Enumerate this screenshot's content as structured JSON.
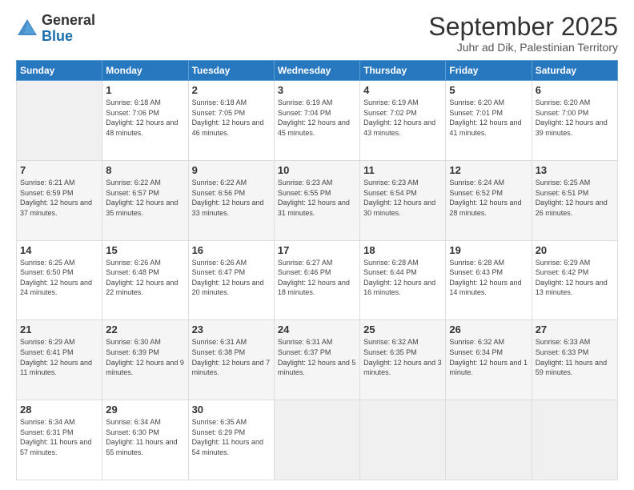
{
  "header": {
    "logo_general": "General",
    "logo_blue": "Blue",
    "month_title": "September 2025",
    "subtitle": "Juhr ad Dik, Palestinian Territory"
  },
  "days_of_week": [
    "Sunday",
    "Monday",
    "Tuesday",
    "Wednesday",
    "Thursday",
    "Friday",
    "Saturday"
  ],
  "weeks": [
    [
      {
        "day": "",
        "sunrise": "",
        "sunset": "",
        "daylight": ""
      },
      {
        "day": "1",
        "sunrise": "Sunrise: 6:18 AM",
        "sunset": "Sunset: 7:06 PM",
        "daylight": "Daylight: 12 hours and 48 minutes."
      },
      {
        "day": "2",
        "sunrise": "Sunrise: 6:18 AM",
        "sunset": "Sunset: 7:05 PM",
        "daylight": "Daylight: 12 hours and 46 minutes."
      },
      {
        "day": "3",
        "sunrise": "Sunrise: 6:19 AM",
        "sunset": "Sunset: 7:04 PM",
        "daylight": "Daylight: 12 hours and 45 minutes."
      },
      {
        "day": "4",
        "sunrise": "Sunrise: 6:19 AM",
        "sunset": "Sunset: 7:02 PM",
        "daylight": "Daylight: 12 hours and 43 minutes."
      },
      {
        "day": "5",
        "sunrise": "Sunrise: 6:20 AM",
        "sunset": "Sunset: 7:01 PM",
        "daylight": "Daylight: 12 hours and 41 minutes."
      },
      {
        "day": "6",
        "sunrise": "Sunrise: 6:20 AM",
        "sunset": "Sunset: 7:00 PM",
        "daylight": "Daylight: 12 hours and 39 minutes."
      }
    ],
    [
      {
        "day": "7",
        "sunrise": "Sunrise: 6:21 AM",
        "sunset": "Sunset: 6:59 PM",
        "daylight": "Daylight: 12 hours and 37 minutes."
      },
      {
        "day": "8",
        "sunrise": "Sunrise: 6:22 AM",
        "sunset": "Sunset: 6:57 PM",
        "daylight": "Daylight: 12 hours and 35 minutes."
      },
      {
        "day": "9",
        "sunrise": "Sunrise: 6:22 AM",
        "sunset": "Sunset: 6:56 PM",
        "daylight": "Daylight: 12 hours and 33 minutes."
      },
      {
        "day": "10",
        "sunrise": "Sunrise: 6:23 AM",
        "sunset": "Sunset: 6:55 PM",
        "daylight": "Daylight: 12 hours and 31 minutes."
      },
      {
        "day": "11",
        "sunrise": "Sunrise: 6:23 AM",
        "sunset": "Sunset: 6:54 PM",
        "daylight": "Daylight: 12 hours and 30 minutes."
      },
      {
        "day": "12",
        "sunrise": "Sunrise: 6:24 AM",
        "sunset": "Sunset: 6:52 PM",
        "daylight": "Daylight: 12 hours and 28 minutes."
      },
      {
        "day": "13",
        "sunrise": "Sunrise: 6:25 AM",
        "sunset": "Sunset: 6:51 PM",
        "daylight": "Daylight: 12 hours and 26 minutes."
      }
    ],
    [
      {
        "day": "14",
        "sunrise": "Sunrise: 6:25 AM",
        "sunset": "Sunset: 6:50 PM",
        "daylight": "Daylight: 12 hours and 24 minutes."
      },
      {
        "day": "15",
        "sunrise": "Sunrise: 6:26 AM",
        "sunset": "Sunset: 6:48 PM",
        "daylight": "Daylight: 12 hours and 22 minutes."
      },
      {
        "day": "16",
        "sunrise": "Sunrise: 6:26 AM",
        "sunset": "Sunset: 6:47 PM",
        "daylight": "Daylight: 12 hours and 20 minutes."
      },
      {
        "day": "17",
        "sunrise": "Sunrise: 6:27 AM",
        "sunset": "Sunset: 6:46 PM",
        "daylight": "Daylight: 12 hours and 18 minutes."
      },
      {
        "day": "18",
        "sunrise": "Sunrise: 6:28 AM",
        "sunset": "Sunset: 6:44 PM",
        "daylight": "Daylight: 12 hours and 16 minutes."
      },
      {
        "day": "19",
        "sunrise": "Sunrise: 6:28 AM",
        "sunset": "Sunset: 6:43 PM",
        "daylight": "Daylight: 12 hours and 14 minutes."
      },
      {
        "day": "20",
        "sunrise": "Sunrise: 6:29 AM",
        "sunset": "Sunset: 6:42 PM",
        "daylight": "Daylight: 12 hours and 13 minutes."
      }
    ],
    [
      {
        "day": "21",
        "sunrise": "Sunrise: 6:29 AM",
        "sunset": "Sunset: 6:41 PM",
        "daylight": "Daylight: 12 hours and 11 minutes."
      },
      {
        "day": "22",
        "sunrise": "Sunrise: 6:30 AM",
        "sunset": "Sunset: 6:39 PM",
        "daylight": "Daylight: 12 hours and 9 minutes."
      },
      {
        "day": "23",
        "sunrise": "Sunrise: 6:31 AM",
        "sunset": "Sunset: 6:38 PM",
        "daylight": "Daylight: 12 hours and 7 minutes."
      },
      {
        "day": "24",
        "sunrise": "Sunrise: 6:31 AM",
        "sunset": "Sunset: 6:37 PM",
        "daylight": "Daylight: 12 hours and 5 minutes."
      },
      {
        "day": "25",
        "sunrise": "Sunrise: 6:32 AM",
        "sunset": "Sunset: 6:35 PM",
        "daylight": "Daylight: 12 hours and 3 minutes."
      },
      {
        "day": "26",
        "sunrise": "Sunrise: 6:32 AM",
        "sunset": "Sunset: 6:34 PM",
        "daylight": "Daylight: 12 hours and 1 minute."
      },
      {
        "day": "27",
        "sunrise": "Sunrise: 6:33 AM",
        "sunset": "Sunset: 6:33 PM",
        "daylight": "Daylight: 11 hours and 59 minutes."
      }
    ],
    [
      {
        "day": "28",
        "sunrise": "Sunrise: 6:34 AM",
        "sunset": "Sunset: 6:31 PM",
        "daylight": "Daylight: 11 hours and 57 minutes."
      },
      {
        "day": "29",
        "sunrise": "Sunrise: 6:34 AM",
        "sunset": "Sunset: 6:30 PM",
        "daylight": "Daylight: 11 hours and 55 minutes."
      },
      {
        "day": "30",
        "sunrise": "Sunrise: 6:35 AM",
        "sunset": "Sunset: 6:29 PM",
        "daylight": "Daylight: 11 hours and 54 minutes."
      },
      {
        "day": "",
        "sunrise": "",
        "sunset": "",
        "daylight": ""
      },
      {
        "day": "",
        "sunrise": "",
        "sunset": "",
        "daylight": ""
      },
      {
        "day": "",
        "sunrise": "",
        "sunset": "",
        "daylight": ""
      },
      {
        "day": "",
        "sunrise": "",
        "sunset": "",
        "daylight": ""
      }
    ]
  ]
}
